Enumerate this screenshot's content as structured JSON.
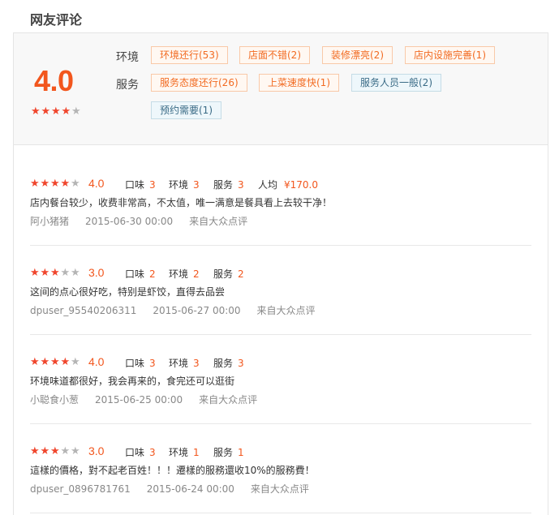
{
  "section_title": "网友评论",
  "summary": {
    "score": "4.0",
    "stars": 4,
    "environment_label": "环境",
    "service_label": "服务",
    "environment_tags": [
      "环境还行(53)",
      "店面不错(2)",
      "装修漂亮(2)",
      "店内设施完善(1)"
    ],
    "service_tags": [
      "服务态度还行(26)",
      "上菜速度快(1)",
      "服务人员一般(2)"
    ],
    "extra_tags": [
      "预约需要(1)"
    ]
  },
  "labels": {
    "taste": "口味",
    "environment": "环境",
    "service": "服务",
    "avg_price": "人均"
  },
  "colors": {
    "accent": "#f2561d",
    "star_on": "#f0462d",
    "star_off": "#b5b5b5",
    "tag_border": "#f9c9a8",
    "tag_neutral_bg": "#eef7fb"
  },
  "reviews": [
    {
      "stars": 4,
      "score": "4.0",
      "taste": "3",
      "environment": "3",
      "service": "3",
      "avg_price": "¥170.0",
      "text": "店内餐台较少，收费非常高，不太值，唯一满意是餐具看上去较干净！",
      "user": "阿小猪猪",
      "date": "2015-06-30 00:00",
      "source": "来自大众点评"
    },
    {
      "stars": 3,
      "score": "3.0",
      "taste": "2",
      "environment": "2",
      "service": "2",
      "text": "这间的点心很好吃，特别是虾饺，直得去品尝",
      "user": "dpuser_95540206311",
      "date": "2015-06-27 00:00",
      "source": "来自大众点评"
    },
    {
      "stars": 4,
      "score": "4.0",
      "taste": "3",
      "environment": "3",
      "service": "3",
      "text": "环境味道都很好，我会再来的，食完还可以逛街",
      "user": "小聪食小葱",
      "date": "2015-06-25 00:00",
      "source": "来自大众点评"
    },
    {
      "stars": 3,
      "score": "3.0",
      "taste": "3",
      "environment": "1",
      "service": "1",
      "text": "這樣的價格，對不起老百姓！！！遷樣的服務還收10%的服務費！",
      "user": "dpuser_0896781761",
      "date": "2015-06-24 00:00",
      "source": "来自大众点评"
    }
  ]
}
